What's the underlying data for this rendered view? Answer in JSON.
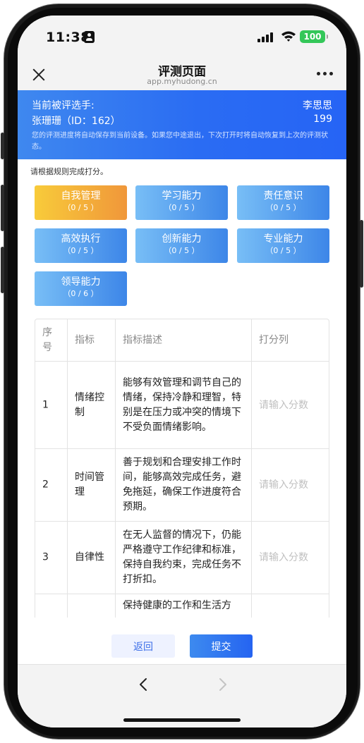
{
  "status_bar": {
    "time": "11:38",
    "battery": "100",
    "battery_color": "#34c759"
  },
  "navbar": {
    "title": "评测页面",
    "url": "app.myhudong.cn",
    "close_icon": "close-icon",
    "more_icon": "more-dots-icon"
  },
  "banner": {
    "candidate_label": "当前被评选手:",
    "candidate_name": "张珊珊（ID：162）",
    "judge_name": "李思思",
    "judge_count": "199",
    "note": "您的评测进度将自动保存到当前设备。如果您中途退出，下次打开时将自动恢复到上次的评测状态。"
  },
  "hint": "请根据规则完成打分。",
  "categories": [
    {
      "name": "自我管理",
      "score": "（0 / 5 ）",
      "active": true
    },
    {
      "name": "学习能力",
      "score": "（0 / 5 ）",
      "active": false
    },
    {
      "name": "责任意识",
      "score": "（0 / 5 ）",
      "active": false
    },
    {
      "name": "高效执行",
      "score": "（0 / 5 ）",
      "active": false
    },
    {
      "name": "创新能力",
      "score": "（0 / 5 ）",
      "active": false
    },
    {
      "name": "专业能力",
      "score": "（0 / 5 ）",
      "active": false
    },
    {
      "name": "领导能力",
      "score": "（0 / 6 ）",
      "active": false
    }
  ],
  "table": {
    "headers": [
      "序号",
      "指标",
      "指标描述",
      "打分列"
    ],
    "placeholder": "请输入分数",
    "rows": [
      {
        "no": "1",
        "indicator": "情绪控制",
        "description": "能够有效管理和调节自己的情绪，保持冷静和理智，特别是在压力或冲突的情境下不受负面情绪影响。",
        "score": ""
      },
      {
        "no": "2",
        "indicator": "时间管理",
        "description": "善于规划和合理安排工作时间，能够高效完成任务，避免拖延，确保工作进度符合预期。",
        "score": ""
      },
      {
        "no": "3",
        "indicator": "自律性",
        "description": "在无人监督的情况下，仍能严格遵守工作纪律和标准，保持自我约束，完成任务不打折扣。",
        "score": ""
      },
      {
        "no": "",
        "indicator": "",
        "description": "保持健康的工作和生活方",
        "score": ""
      }
    ]
  },
  "actions": {
    "back_label": "返回",
    "submit_label": "提交"
  },
  "browser_nav": {
    "back_icon": "chevron-left-icon",
    "forward_icon": "chevron-right-icon"
  },
  "colors": {
    "accent_blue": "#2a6cf3",
    "active_tab": "#f0973a",
    "category_blue": "#3d86e8"
  }
}
